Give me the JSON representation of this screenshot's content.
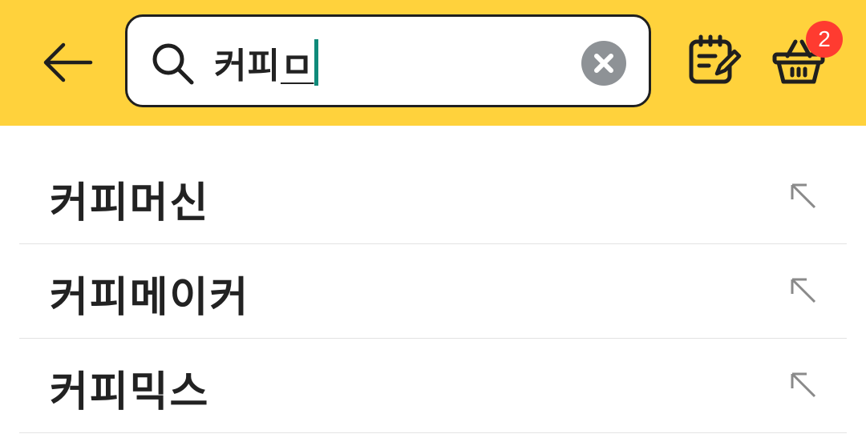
{
  "header": {
    "back_icon": "arrow-left-icon",
    "search": {
      "icon": "search-icon",
      "committed_text": "커피",
      "composing_text": "ㅁ",
      "clear_icon": "close-circle-icon"
    },
    "memo_icon": "notepad-edit-icon",
    "cart": {
      "icon": "shopping-basket-icon",
      "badge_count": "2"
    },
    "colors": {
      "bar_background": "#FFD23C",
      "badge": "#FF3B30",
      "caret": "#0f8a7a"
    }
  },
  "suggestions": [
    {
      "label": "커피머신",
      "action_icon": "arrow-up-left-icon"
    },
    {
      "label": "커피메이커",
      "action_icon": "arrow-up-left-icon"
    },
    {
      "label": "커피믹스",
      "action_icon": "arrow-up-left-icon"
    }
  ]
}
